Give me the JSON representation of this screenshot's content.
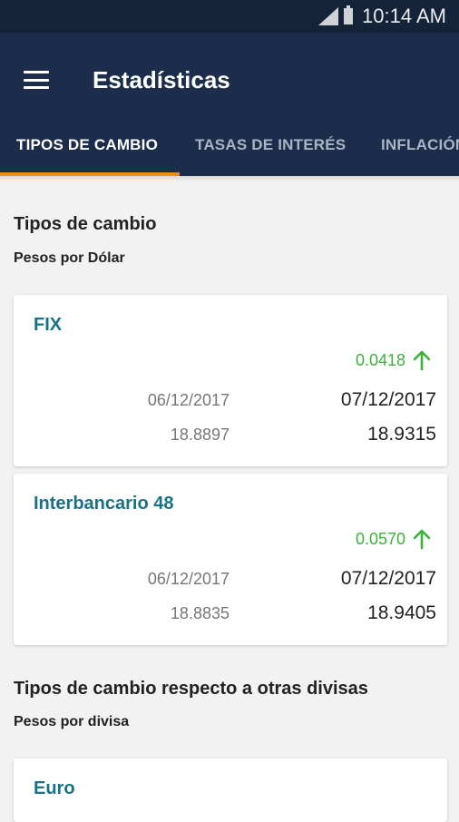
{
  "status_bar": {
    "time": "10:14 AM",
    "icons": [
      "signal-icon",
      "battery-icon"
    ]
  },
  "app_bar": {
    "title": "Estadísticas",
    "menu_icon": "menu-icon"
  },
  "tabs": [
    {
      "label": "TIPOS DE CAMBIO",
      "active": true
    },
    {
      "label": "TASAS DE INTERÉS",
      "active": false
    },
    {
      "label": "INFLACIÓN",
      "active": false
    }
  ],
  "section1": {
    "title": "Tipos de cambio",
    "subtitle": "Pesos por Dólar"
  },
  "cards": [
    {
      "name": "FIX",
      "change": "0.0418",
      "change_direction": "up",
      "prev_date": "06/12/2017",
      "cur_date": "07/12/2017",
      "prev_value": "18.8897",
      "cur_value": "18.9315"
    },
    {
      "name": "Interbancario 48",
      "change": "0.0570",
      "change_direction": "up",
      "prev_date": "06/12/2017",
      "cur_date": "07/12/2017",
      "prev_value": "18.8835",
      "cur_value": "18.9405"
    }
  ],
  "section2": {
    "title": "Tipos de cambio respecto a otras divisas",
    "subtitle": "Pesos por divisa"
  },
  "partial_card": {
    "name": "Euro"
  },
  "colors": {
    "app_bar": "#1b2d4b",
    "status_bar": "#142337",
    "tab_indicator": "#ef8a24",
    "card_title": "#1a7287",
    "positive_change": "#3ab23a"
  }
}
